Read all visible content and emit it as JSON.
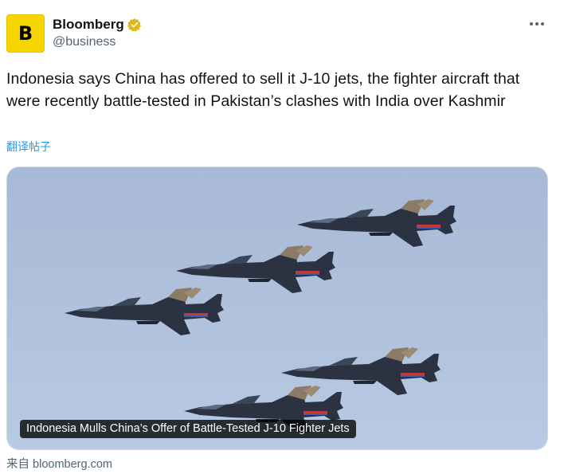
{
  "account": {
    "display_name": "Bloomberg",
    "handle": "@business",
    "avatar_letter": "B",
    "avatar_color": "#f5d400",
    "verified_badge_color": "#e2b719"
  },
  "tweet": {
    "text": "Indonesia says China has offered to sell it J-10 jets, the fighter aircraft that were recently battle-tested in Pakistan’s clashes with India over Kashmir",
    "translate_label": "翻译帖子"
  },
  "media": {
    "caption": "Indonesia Mulls China’s Offer of Battle-Tested J-10 Fighter Jets",
    "sky_color": "#aebfda",
    "jet_color": "#2c3444"
  },
  "source": {
    "label": "来自 bloomberg.com"
  },
  "colors": {
    "link_blue": "#1d9bf0",
    "secondary_text": "#536471",
    "primary_text": "#0f1419"
  }
}
